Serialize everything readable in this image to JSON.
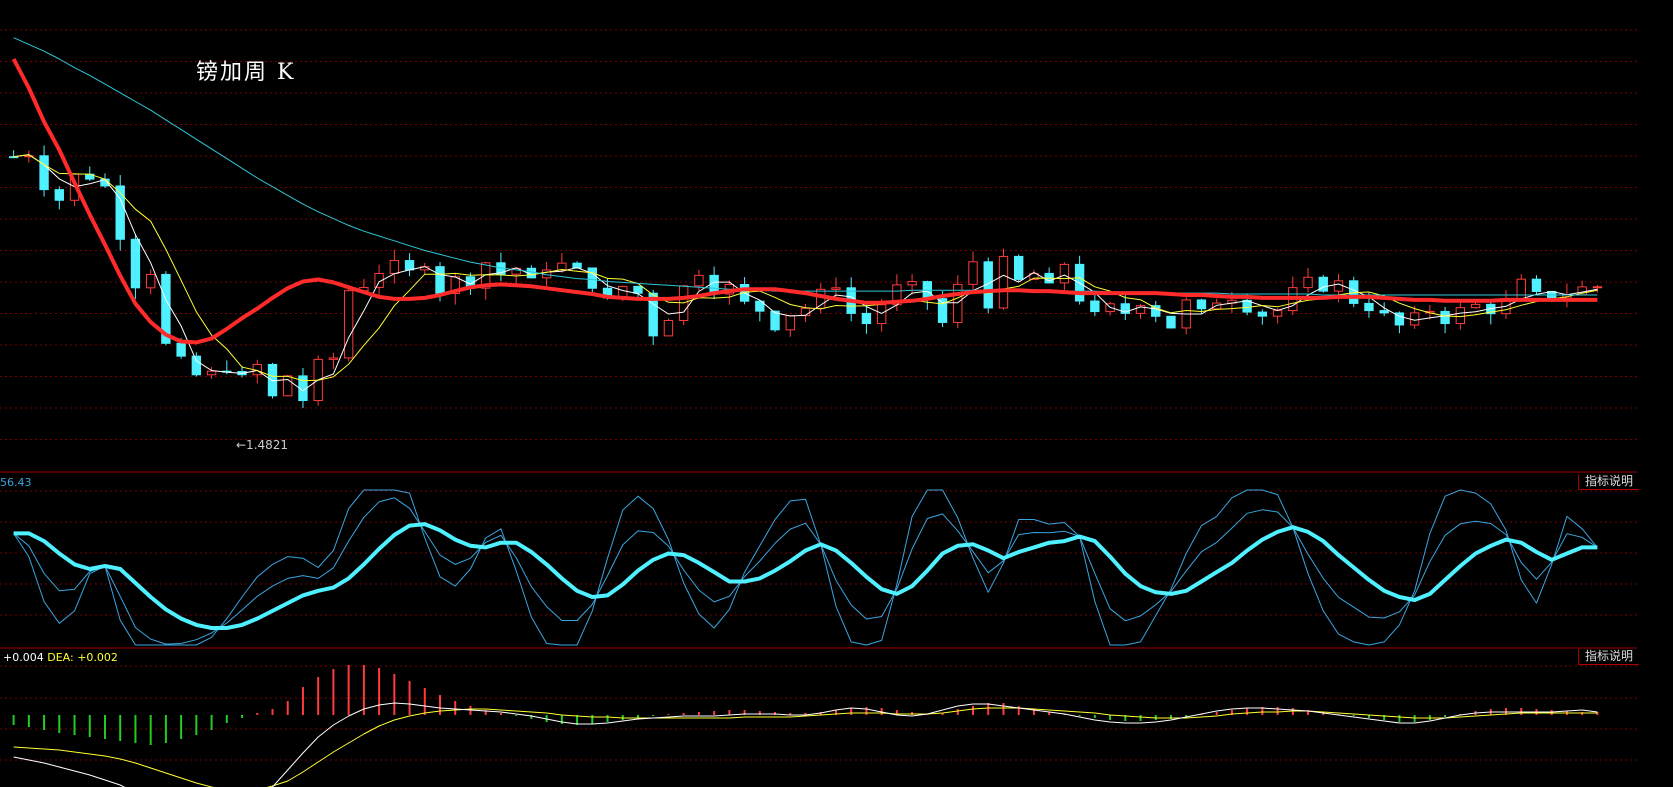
{
  "header": {
    "title": "镑加周 K"
  },
  "panels": {
    "main": {
      "min_price_label": "←1.4821"
    },
    "kdj": {
      "value_label": "56.43",
      "button_label": "指标说明"
    },
    "macd": {
      "macd_label": "+0.004",
      "dea_prefix": "DEA:",
      "dea_value": "+0.002",
      "button_label": "指标说明"
    }
  },
  "colors": {
    "background": "#000000",
    "grid": "#7a0000",
    "separator": "#a00000",
    "up_candle": "#ff3b3b",
    "down_candle": "#4ff0ff",
    "ma5": "#ffffff",
    "ma10": "#ffff33",
    "ma20": "#ff2a2a",
    "ma60": "#2ec8d8",
    "kdj_main": "#4ff0ff",
    "kdj_thin": "#3aa6e0",
    "macd_dif": "#ffffff",
    "macd_dea": "#ffff33",
    "hist_pos": "#ff3b3b",
    "hist_neg": "#22cc22"
  },
  "chart_data": [
    {
      "type": "candlestick",
      "panel": "price",
      "candle_count": 105,
      "ylim": [
        1.44,
        1.87
      ],
      "annotations": [
        {
          "text": "←1.4821",
          "value": 1.4821
        }
      ],
      "series": [
        {
          "name": "",
          "values": [
            1.737,
            1.741,
            1.708,
            1.693,
            1.717,
            1.717,
            1.706,
            1.657,
            1.606,
            1.619,
            1.542,
            1.525,
            1.511,
            1.512,
            1.52,
            1.507,
            1.521,
            1.488,
            1.511,
            1.486,
            1.522,
            1.529,
            1.599,
            1.605,
            1.619,
            1.624,
            1.617,
            1.629,
            1.599,
            1.61,
            1.607,
            1.628,
            1.616,
            1.622,
            1.607,
            1.624,
            1.625,
            1.618,
            1.606,
            1.587,
            1.603,
            1.596,
            1.555,
            1.572,
            1.602,
            1.619,
            1.601,
            1.602,
            1.585,
            1.579,
            1.563,
            1.575,
            1.581,
            1.595,
            1.606,
            1.575,
            1.565,
            1.585,
            1.601,
            1.602,
            1.591,
            1.565,
            1.602,
            1.629,
            1.586,
            1.628,
            1.608,
            1.616,
            1.601,
            1.627,
            1.591,
            1.572,
            1.581,
            1.576,
            1.588,
            1.575,
            1.562,
            1.586,
            1.575,
            1.589,
            1.593,
            1.582,
            1.574,
            1.578,
            1.597,
            1.607,
            1.603,
            1.606,
            1.588,
            1.582,
            1.572,
            1.562,
            1.57,
            1.579,
            1.569,
            1.578,
            1.583,
            1.579,
            1.585,
            1.606,
            1.593,
            1.594,
            1.596,
            1.601,
            1.603
          ]
        },
        {
          "name": "",
          "values": [
            1.838,
            1.808,
            1.773,
            1.744,
            1.71,
            1.677,
            1.646,
            1.614,
            1.585,
            1.566,
            1.553,
            1.546,
            1.545,
            1.549,
            1.559,
            1.57,
            1.58,
            1.591,
            1.601,
            1.608,
            1.61,
            1.607,
            1.602,
            1.597,
            1.592,
            1.59,
            1.59,
            1.591,
            1.594,
            1.598,
            1.602,
            1.604,
            1.605,
            1.604,
            1.603,
            1.601,
            1.599,
            1.597,
            1.595,
            1.592,
            1.591,
            1.59,
            1.59,
            1.59,
            1.591,
            1.593,
            1.596,
            1.598,
            1.6,
            1.6,
            1.6,
            1.598,
            1.596,
            1.593,
            1.59,
            1.588,
            1.586,
            1.586,
            1.587,
            1.588,
            1.59,
            1.593,
            1.595,
            1.597,
            1.598,
            1.599,
            1.599,
            1.598,
            1.598,
            1.597,
            1.596,
            1.596,
            1.596,
            1.596,
            1.596,
            1.596,
            1.595,
            1.594,
            1.594,
            1.593,
            1.592,
            1.592,
            1.591,
            1.591,
            1.591,
            1.591,
            1.591,
            1.592,
            1.592,
            1.592,
            1.591,
            1.59,
            1.589,
            1.589,
            1.588,
            1.588,
            1.588,
            1.588,
            1.589,
            1.589,
            1.589,
            1.589,
            1.589,
            1.589,
            1.589
          ]
        },
        {
          "name": "",
          "values": [
            1.86,
            1.853,
            1.846,
            1.838,
            1.829,
            1.821,
            1.812,
            1.803,
            1.794,
            1.785,
            1.775,
            1.765,
            1.755,
            1.745,
            1.735,
            1.725,
            1.715,
            1.706,
            1.697,
            1.688,
            1.68,
            1.673,
            1.666,
            1.66,
            1.655,
            1.65,
            1.645,
            1.64,
            1.636,
            1.632,
            1.628,
            1.625,
            1.622,
            1.62,
            1.618,
            1.615,
            1.613,
            1.611,
            1.61,
            1.608,
            1.607,
            1.606,
            1.605,
            1.604,
            1.603,
            1.602,
            1.601,
            1.6,
            1.6,
            1.599,
            1.598,
            1.598,
            1.598,
            1.598,
            1.598,
            1.598,
            1.598,
            1.598,
            1.598,
            1.599,
            1.599,
            1.599,
            1.599,
            1.599,
            1.599,
            1.599,
            1.599,
            1.599,
            1.599,
            1.598,
            1.598,
            1.598,
            1.597,
            1.597,
            1.597,
            1.597,
            1.596,
            1.596,
            1.596,
            1.596,
            1.595,
            1.595,
            1.595,
            1.595,
            1.595,
            1.595,
            1.594,
            1.594,
            1.594,
            1.594,
            1.594,
            1.594,
            1.594,
            1.594,
            1.594,
            1.594,
            1.594,
            1.594,
            1.594,
            1.594,
            1.594,
            1.594,
            1.594,
            1.594,
            1.594
          ]
        }
      ]
    },
    {
      "type": "line",
      "panel": "kdj",
      "ylim": [
        0,
        100
      ],
      "series": [
        {
          "name": "",
          "values": [
            72,
            72,
            67,
            59,
            52,
            49,
            51,
            49,
            40,
            31,
            23,
            17,
            13,
            11,
            11,
            13,
            17,
            22,
            27,
            32,
            35,
            37,
            43,
            52,
            62,
            71,
            77,
            78,
            74,
            68,
            64,
            63,
            66,
            66,
            60,
            52,
            43,
            35,
            31,
            32,
            39,
            48,
            55,
            59,
            58,
            53,
            47,
            41,
            41,
            43,
            48,
            54,
            61,
            65,
            61,
            53,
            44,
            36,
            33,
            38,
            48,
            59,
            64,
            65,
            61,
            56,
            60,
            63,
            66,
            67,
            70,
            67,
            57,
            46,
            38,
            34,
            33,
            35,
            41,
            47,
            53,
            61,
            68,
            73,
            76,
            73,
            67,
            58,
            50,
            42,
            35,
            31,
            29,
            33,
            42,
            51,
            59,
            64,
            68,
            66,
            60,
            55,
            59,
            63,
            63
          ]
        }
      ]
    },
    {
      "type": "bar",
      "panel": "macd",
      "series": [
        {
          "name": "",
          "values": [
            -10,
            -12,
            -15,
            -18,
            -20,
            -22,
            -24,
            -26,
            -28,
            -30,
            -28,
            -24,
            -20,
            -15,
            -8,
            -3,
            2,
            6,
            14,
            28,
            38,
            46,
            50,
            50,
            47,
            41,
            34,
            27,
            20,
            14,
            9,
            5,
            2,
            -1,
            -4,
            -7,
            -9,
            -10,
            -9,
            -7,
            -5,
            -3,
            -1,
            1,
            2,
            3,
            4,
            5,
            5,
            4,
            3,
            2,
            2,
            3,
            5,
            7,
            8,
            7,
            5,
            3,
            1,
            2,
            6,
            9,
            12,
            12,
            9,
            6,
            3,
            1,
            -1,
            -3,
            -5,
            -6,
            -6,
            -5,
            -4,
            -2,
            1,
            3,
            5,
            7,
            8,
            8,
            7,
            5,
            3,
            1,
            -1,
            -3,
            -5,
            -7,
            -7,
            -5,
            -2,
            1,
            4,
            6,
            7,
            7,
            6,
            5,
            4,
            3,
            3
          ]
        },
        {
          "name": "",
          "values": [
            -42,
            -45,
            -48,
            -52,
            -56,
            -60,
            -65,
            -70,
            -78,
            -86,
            -94,
            -100,
            -103,
            -104,
            -102,
            -96,
            -86,
            -72,
            -55,
            -38,
            -22,
            -10,
            -1,
            6,
            10,
            12,
            11,
            9,
            7,
            6,
            5,
            4,
            3,
            1,
            -1,
            -4,
            -7,
            -9,
            -9,
            -8,
            -6,
            -4,
            -3,
            -2,
            -1,
            -1,
            -1,
            0,
            1,
            1,
            1,
            0,
            0,
            2,
            5,
            7,
            6,
            3,
            0,
            -1,
            1,
            5,
            9,
            11,
            11,
            9,
            7,
            5,
            3,
            1,
            -2,
            -5,
            -7,
            -8,
            -8,
            -7,
            -5,
            -2,
            1,
            4,
            6,
            7,
            7,
            6,
            5,
            4,
            2,
            0,
            -2,
            -4,
            -6,
            -8,
            -8,
            -6,
            -3,
            0,
            2,
            3,
            3,
            3,
            3,
            3,
            4,
            5,
            3
          ]
        },
        {
          "name": "",
          "values": [
            -32,
            -33,
            -34,
            -35,
            -37,
            -39,
            -41,
            -44,
            -48,
            -53,
            -58,
            -63,
            -68,
            -72,
            -75,
            -76,
            -75,
            -71,
            -66,
            -57,
            -47,
            -37,
            -28,
            -19,
            -11,
            -5,
            -1,
            2,
            4,
            5,
            6,
            6,
            5,
            4,
            3,
            2,
            0,
            -1,
            -2,
            -2,
            -3,
            -3,
            -3,
            -3,
            -3,
            -3,
            -3,
            -3,
            -2,
            -2,
            -2,
            -2,
            -1,
            0,
            1,
            2,
            2,
            2,
            1,
            1,
            1,
            2,
            4,
            6,
            7,
            7,
            7,
            6,
            5,
            4,
            3,
            2,
            0,
            -1,
            -2,
            -3,
            -3,
            -3,
            -2,
            -1,
            1,
            2,
            3,
            3,
            4,
            4,
            3,
            2,
            1,
            0,
            -1,
            -2,
            -3,
            -3,
            -3,
            -2,
            -1,
            0,
            1,
            2,
            2,
            2,
            2,
            2,
            2
          ]
        }
      ]
    }
  ]
}
